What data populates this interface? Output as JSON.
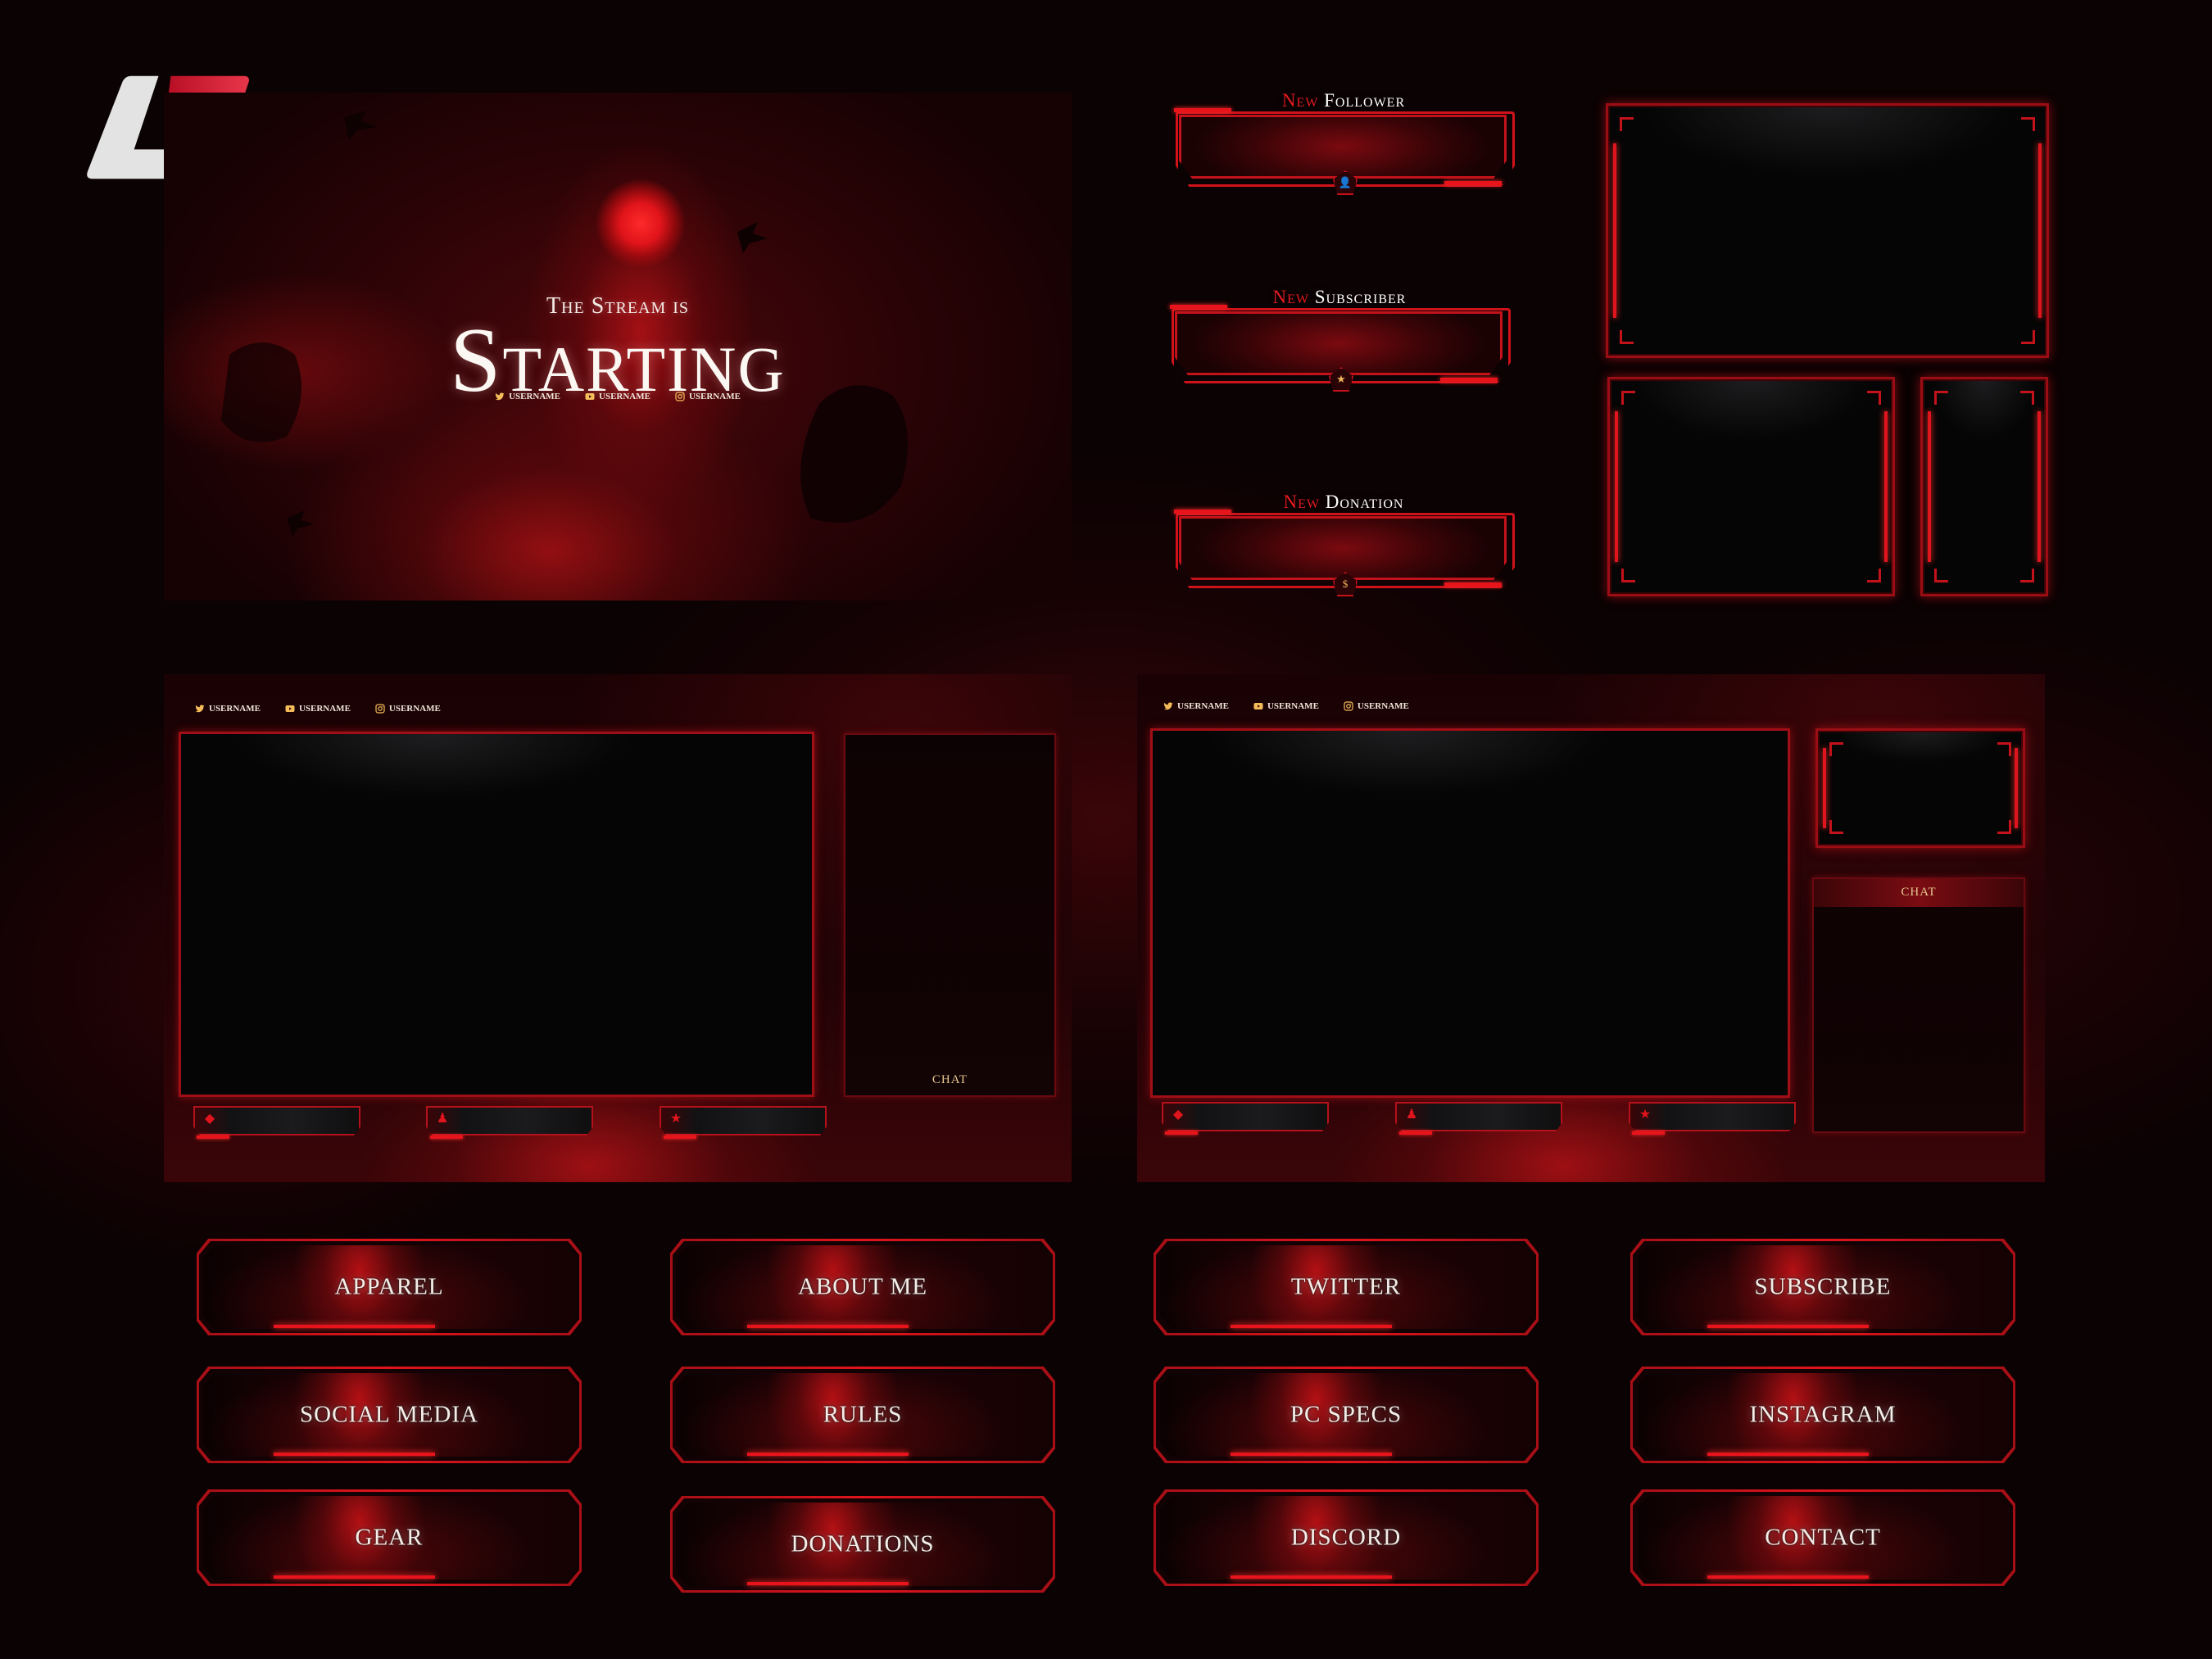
{
  "brand": {
    "logo_name": "brand-logo",
    "colors": {
      "accent": "#e0141c",
      "logo_red": "#d41f33",
      "logo_white": "#e3e3e3",
      "gold": "#f0b45a",
      "background": "#0b0203"
    }
  },
  "starting_screen": {
    "subtitle": "The Stream is",
    "title": "Starting",
    "socials": [
      {
        "icon": "twitter-icon",
        "label": "USERNAME"
      },
      {
        "icon": "youtube-icon",
        "label": "USERNAME"
      },
      {
        "icon": "instagram-icon",
        "label": "USERNAME"
      }
    ]
  },
  "alerts": [
    {
      "new_word": "New",
      "type": "Follower",
      "icon": "user-plus-icon"
    },
    {
      "new_word": "New",
      "type": "Subscriber",
      "icon": "star-icon"
    },
    {
      "new_word": "New",
      "type": "Donation",
      "icon": "dollar-coin-icon"
    }
  ],
  "overlay_left": {
    "socials": [
      {
        "icon": "twitter-icon",
        "label": "USERNAME"
      },
      {
        "icon": "youtube-icon",
        "label": "USERNAME"
      },
      {
        "icon": "instagram-icon",
        "label": "USERNAME"
      }
    ],
    "chat_label": "CHAT",
    "stats": [
      {
        "icon": "gem-icon"
      },
      {
        "icon": "user-plus-icon"
      },
      {
        "icon": "star-icon"
      }
    ]
  },
  "overlay_right": {
    "socials": [
      {
        "icon": "twitter-icon",
        "label": "USERNAME"
      },
      {
        "icon": "youtube-icon",
        "label": "USERNAME"
      },
      {
        "icon": "instagram-icon",
        "label": "USERNAME"
      }
    ],
    "chat_label": "CHAT",
    "stats": [
      {
        "icon": "gem-icon"
      },
      {
        "icon": "user-plus-icon"
      },
      {
        "icon": "star-icon"
      }
    ]
  },
  "panels": [
    [
      "APPAREL",
      "ABOUT ME",
      "TWITTER",
      "SUBSCRIBE"
    ],
    [
      "SOCIAL MEDIA",
      "RULES",
      "PC SPECS",
      "INSTAGRAM"
    ],
    [
      "GEAR",
      "DONATIONS",
      "DISCORD",
      "CONTACT"
    ]
  ]
}
